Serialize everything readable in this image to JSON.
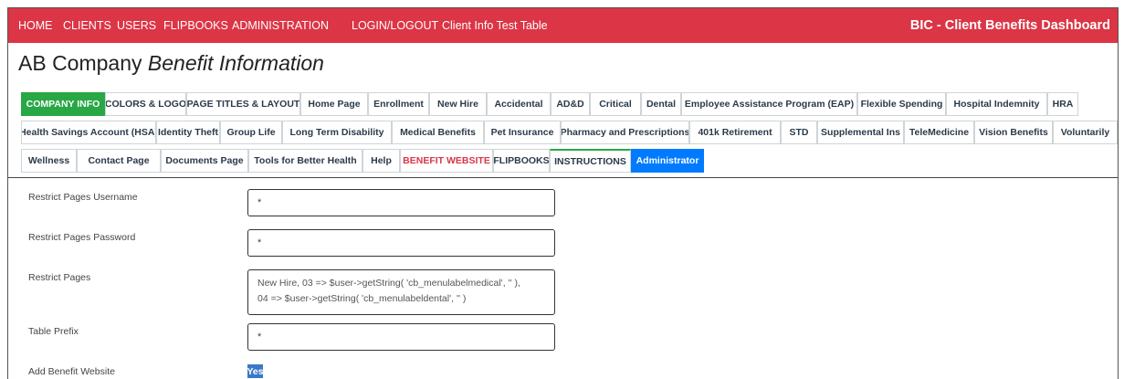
{
  "navbar": {
    "items": [
      "HOME",
      "CLIENTS",
      "USERS",
      "FLIPBOOKS",
      "ADMINISTRATION",
      "LOGIN/LOGOUT",
      "Client Info Test Table"
    ],
    "brand": "BIC - Client Benefits Dashboard",
    "color": "#dc3545"
  },
  "page_title": {
    "company": "AB Company",
    "subtitle": "Benefit Information"
  },
  "tabs": {
    "row1": [
      "COMPANY INFO",
      "COLORS & LOGO",
      "PAGE TITLES & LAYOUT",
      "Home Page",
      "Enrollment",
      "New Hire",
      "Accidental",
      "AD&D",
      "Critical",
      "Dental",
      "Employee Assistance Program (EAP)",
      "Flexible Spending",
      "Hospital Indemnity",
      "HRA"
    ],
    "row2": [
      "Health Savings Account (HSA)",
      "Identity Theft",
      "Group Life",
      "Long Term Disability",
      "Medical Benefits",
      "Pet Insurance",
      "Pharmacy and Prescriptions",
      "401k Retirement",
      "STD",
      "Supplemental Ins",
      "TeleMedicine",
      "Vision Benefits",
      "Voluntarily"
    ],
    "row3": [
      "Wellness",
      "Contact Page",
      "Documents Page",
      "Tools for Better Health",
      "Help",
      "BENEFIT WEBSITE",
      "FLIPBOOKS",
      "INSTRUCTIONS",
      "Administrator"
    ],
    "active_color": "#28a745",
    "admin_color": "#007bff"
  },
  "form": {
    "username_label": "Restrict Pages Username",
    "username_value": "*",
    "password_label": "Restrict Pages Password",
    "password_value": "*",
    "restrict_label": "Restrict Pages",
    "restrict_line1": "New Hire, 03 => $user->getString( 'cb_menulabelmedical', '' ),",
    "restrict_line2": "04 => $user->getString( 'cb_menulabeldental', '' )",
    "prefix_label": "Table Prefix",
    "prefix_value": "*",
    "website_label": "Add Benefit Website",
    "website_value": "Yes"
  }
}
